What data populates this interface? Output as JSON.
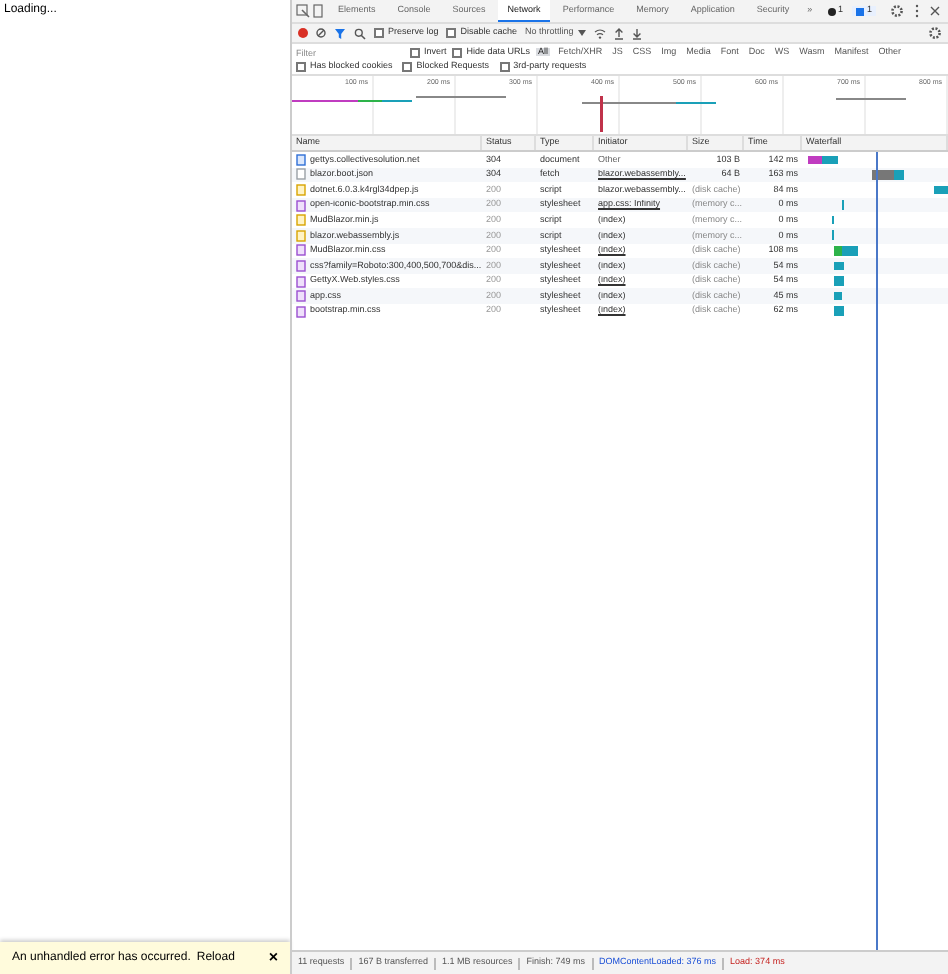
{
  "page": {
    "loading_text": "Loading...",
    "error_bar": {
      "message": "An unhandled error has occurred.",
      "reload": "Reload",
      "close": "×"
    }
  },
  "devtools": {
    "tabs": [
      {
        "label": "Elements",
        "selected": false
      },
      {
        "label": "Console",
        "selected": false
      },
      {
        "label": "Sources",
        "selected": false
      },
      {
        "label": "Network",
        "selected": true
      },
      {
        "label": "Performance",
        "selected": false
      },
      {
        "label": "Memory",
        "selected": false
      },
      {
        "label": "Application",
        "selected": false
      },
      {
        "label": "Security",
        "selected": false
      }
    ],
    "more_tabs": "»",
    "error_count": "1",
    "issue_count": "1",
    "toolbar": {
      "preserve_log": {
        "label": "Preserve log",
        "checked": false
      },
      "disable_cache": {
        "label": "Disable cache",
        "checked": false
      },
      "throttling": "No throttling"
    },
    "filter": {
      "placeholder": "Filter",
      "invert": {
        "label": "Invert",
        "checked": false
      },
      "hide_data_urls": {
        "label": "Hide data URLs",
        "checked": false
      },
      "types": [
        {
          "label": "All",
          "selected": true
        },
        {
          "label": "Fetch/XHR",
          "selected": false
        },
        {
          "label": "JS",
          "selected": false
        },
        {
          "label": "CSS",
          "selected": false
        },
        {
          "label": "Img",
          "selected": false
        },
        {
          "label": "Media",
          "selected": false
        },
        {
          "label": "Font",
          "selected": false
        },
        {
          "label": "Doc",
          "selected": false
        },
        {
          "label": "WS",
          "selected": false
        },
        {
          "label": "Wasm",
          "selected": false
        },
        {
          "label": "Manifest",
          "selected": false
        },
        {
          "label": "Other",
          "selected": false
        }
      ],
      "options": [
        {
          "label": "Has blocked cookies",
          "checked": false
        },
        {
          "label": "Blocked Requests",
          "checked": false
        },
        {
          "label": "3rd-party requests",
          "checked": false
        }
      ]
    },
    "overview_ticks": [
      "100 ms",
      "200 ms",
      "300 ms",
      "400 ms",
      "500 ms",
      "600 ms",
      "700 ms",
      "800 ms"
    ],
    "table": {
      "columns": [
        "Name",
        "Status",
        "Type",
        "Initiator",
        "Size",
        "Time",
        "Waterfall"
      ],
      "rows": [
        {
          "kind": "document",
          "name": "gettys.collectivesolution.net",
          "status": "304",
          "type": "document",
          "initiator": "Other",
          "initiator_link": false,
          "size": "103 B",
          "time": "142 ms",
          "cached": false
        },
        {
          "kind": "fetch",
          "name": "blazor.boot.json",
          "status": "304",
          "type": "fetch",
          "initiator": "blazor.webassembly...",
          "initiator_link": true,
          "size": "64 B",
          "time": "163 ms",
          "cached": false
        },
        {
          "kind": "script",
          "name": "dotnet.6.0.3.k4rgl34dpep.js",
          "status": "200",
          "type": "script",
          "initiator": "blazor.webassembly...",
          "initiator_link": true,
          "size": "(disk cache)",
          "time": "84 ms",
          "cached": true
        },
        {
          "kind": "stylesheet",
          "name": "open-iconic-bootstrap.min.css",
          "status": "200",
          "type": "stylesheet",
          "initiator": "app.css: Infinity",
          "initiator_link": true,
          "size": "(memory c...",
          "time": "0 ms",
          "cached": true
        },
        {
          "kind": "script",
          "name": "MudBlazor.min.js",
          "status": "200",
          "type": "script",
          "initiator": "(index)",
          "initiator_link": true,
          "size": "(memory c...",
          "time": "0 ms",
          "cached": true
        },
        {
          "kind": "script",
          "name": "blazor.webassembly.js",
          "status": "200",
          "type": "script",
          "initiator": "(index)",
          "initiator_link": true,
          "size": "(memory c...",
          "time": "0 ms",
          "cached": true
        },
        {
          "kind": "stylesheet",
          "name": "MudBlazor.min.css",
          "status": "200",
          "type": "stylesheet",
          "initiator": "(index)",
          "initiator_link": true,
          "size": "(disk cache)",
          "time": "108 ms",
          "cached": true
        },
        {
          "kind": "stylesheet",
          "name": "css?family=Roboto:300,400,500,700&dis...",
          "status": "200",
          "type": "stylesheet",
          "initiator": "(index)",
          "initiator_link": true,
          "size": "(disk cache)",
          "time": "54 ms",
          "cached": true
        },
        {
          "kind": "stylesheet",
          "name": "GettyX.Web.styles.css",
          "status": "200",
          "type": "stylesheet",
          "initiator": "(index)",
          "initiator_link": true,
          "size": "(disk cache)",
          "time": "54 ms",
          "cached": true
        },
        {
          "kind": "stylesheet",
          "name": "app.css",
          "status": "200",
          "type": "stylesheet",
          "initiator": "(index)",
          "initiator_link": true,
          "size": "(disk cache)",
          "time": "45 ms",
          "cached": true
        },
        {
          "kind": "stylesheet",
          "name": "bootstrap.min.css",
          "status": "200",
          "type": "stylesheet",
          "initiator": "(index)",
          "initiator_link": true,
          "size": "(disk cache)",
          "time": "62 ms",
          "cached": true
        }
      ]
    },
    "status_bar": {
      "requests": "11 requests",
      "transferred": "167 B transferred",
      "resources": "1.1 MB resources",
      "finish": "Finish: 749 ms",
      "dom_loaded": "DOMContentLoaded: 376 ms",
      "load": "Load: 374 ms"
    }
  }
}
